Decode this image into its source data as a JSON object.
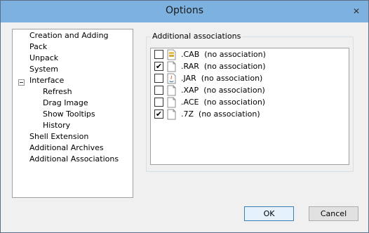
{
  "window": {
    "title": "Options",
    "close_glyph": "✕"
  },
  "tree": {
    "items": [
      {
        "label": "Creation and Adding",
        "level": 0
      },
      {
        "label": "Pack",
        "level": 0
      },
      {
        "label": "Unpack",
        "level": 0
      },
      {
        "label": "System",
        "level": 0
      },
      {
        "label": "Interface",
        "level": 0,
        "expanded": true
      },
      {
        "label": "Refresh",
        "level": 1
      },
      {
        "label": "Drag Image",
        "level": 1
      },
      {
        "label": "Show Tooltips",
        "level": 1
      },
      {
        "label": "History",
        "level": 1
      },
      {
        "label": "Shell Extension",
        "level": 0
      },
      {
        "label": "Additional Archives",
        "level": 0
      },
      {
        "label": "Additional Associations",
        "level": 0
      }
    ]
  },
  "associations": {
    "group_label": "Additional associations",
    "checkmark": "✔",
    "items": [
      {
        "ext": ".CAB",
        "assoc": "(no association)",
        "checked": false,
        "icon": "cab-file-icon"
      },
      {
        "ext": ".RAR",
        "assoc": "(no association)",
        "checked": true,
        "icon": "blank-file-icon"
      },
      {
        "ext": ".JAR",
        "assoc": "(no association)",
        "checked": false,
        "icon": "java-file-icon"
      },
      {
        "ext": ".XAP",
        "assoc": "(no association)",
        "checked": false,
        "icon": "blank-file-icon"
      },
      {
        "ext": ".ACE",
        "assoc": "(no association)",
        "checked": false,
        "icon": "blank-file-icon"
      },
      {
        "ext": ".7Z",
        "assoc": "(no association)",
        "checked": true,
        "icon": "blank-file-icon"
      }
    ]
  },
  "buttons": {
    "ok": "OK",
    "cancel": "Cancel"
  },
  "colors": {
    "titlebar": "#7cb1e0",
    "default_button_border": "#3c7fb1"
  }
}
